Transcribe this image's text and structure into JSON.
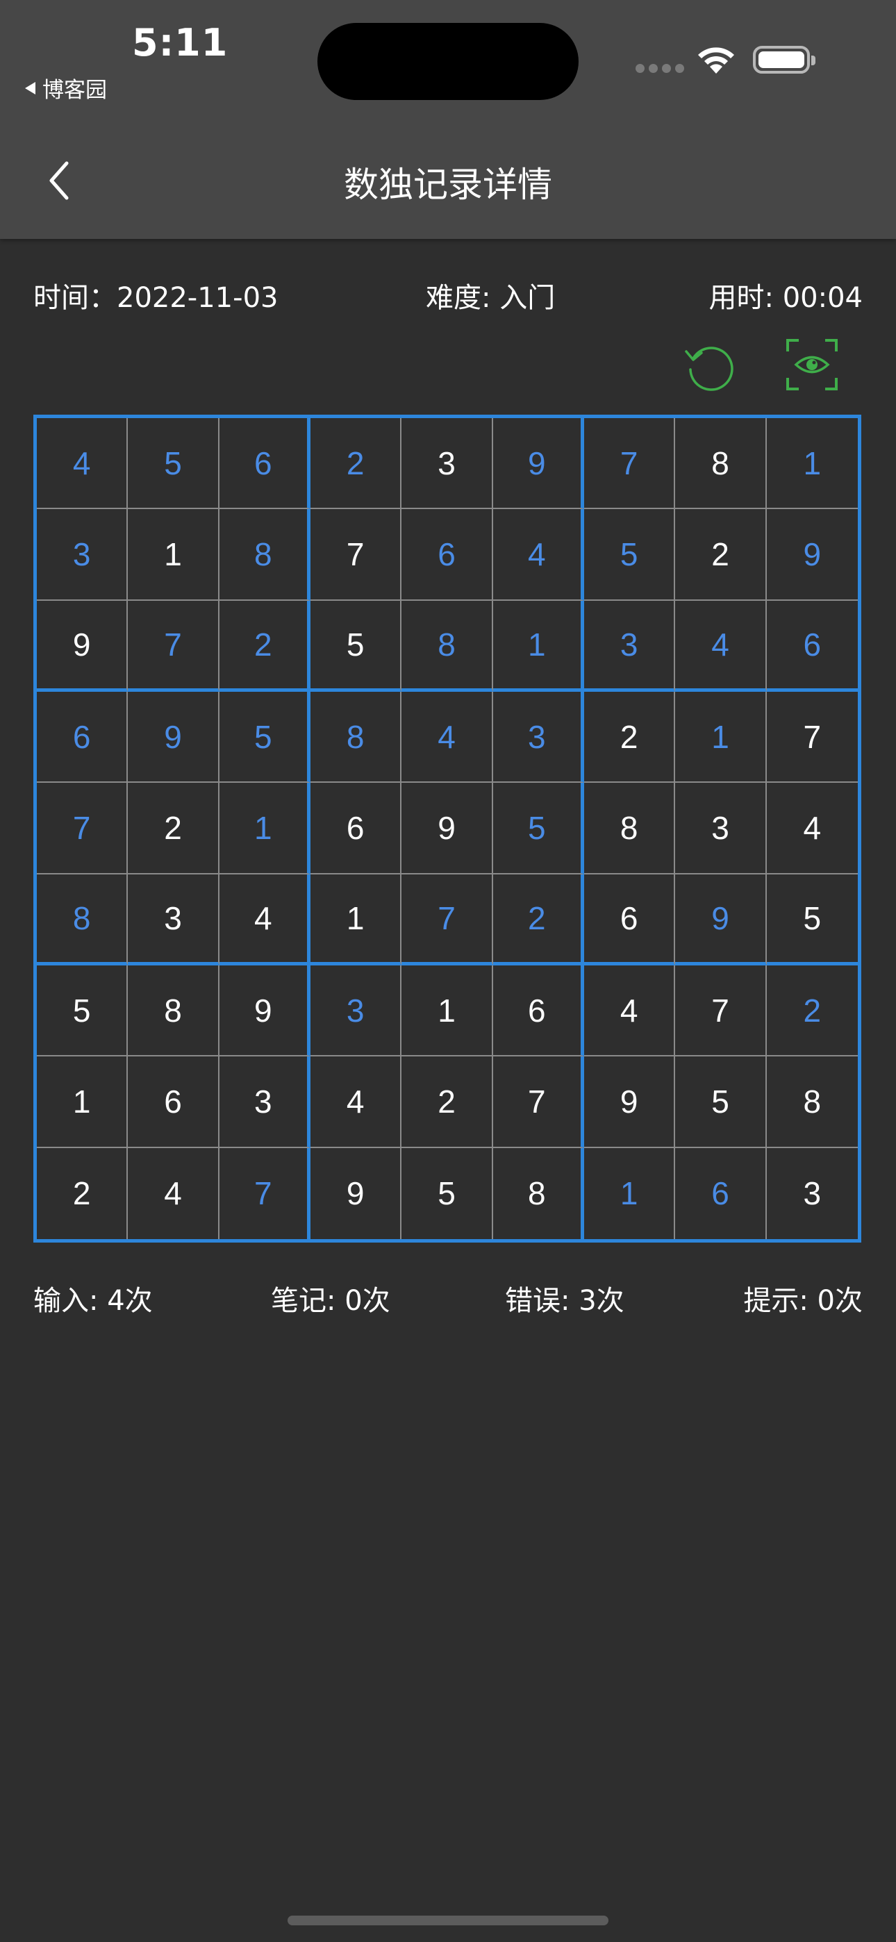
{
  "status_bar": {
    "time": "5:11",
    "back_app": "博客园"
  },
  "nav": {
    "title": "数独记录详情"
  },
  "info": {
    "date_label": "时间：",
    "date_value": "2022-11-03",
    "difficulty_label": "难度: ",
    "difficulty_value": "入门",
    "duration_label": "用时: ",
    "duration_value": "00:04"
  },
  "icons": {
    "restart": "restart-icon",
    "eye": "eye-scan-icon"
  },
  "colors": {
    "grid_border": "#2d86dc",
    "filled_digit": "#4a8ce6",
    "given_digit": "#ffffff",
    "action_icon": "#3fae4a"
  },
  "board": [
    [
      "4",
      "5",
      "6",
      "2",
      "3",
      "9",
      "7",
      "8",
      "1"
    ],
    [
      "3",
      "1",
      "8",
      "7",
      "6",
      "4",
      "5",
      "2",
      "9"
    ],
    [
      "9",
      "7",
      "2",
      "5",
      "8",
      "1",
      "3",
      "4",
      "6"
    ],
    [
      "6",
      "9",
      "5",
      "8",
      "4",
      "3",
      "2",
      "1",
      "7"
    ],
    [
      "7",
      "2",
      "1",
      "6",
      "9",
      "5",
      "8",
      "3",
      "4"
    ],
    [
      "8",
      "3",
      "4",
      "1",
      "7",
      "2",
      "6",
      "9",
      "5"
    ],
    [
      "5",
      "8",
      "9",
      "3",
      "1",
      "6",
      "4",
      "7",
      "2"
    ],
    [
      "1",
      "6",
      "3",
      "4",
      "2",
      "7",
      "9",
      "5",
      "8"
    ],
    [
      "2",
      "4",
      "7",
      "9",
      "5",
      "8",
      "1",
      "6",
      "3"
    ]
  ],
  "board_filled": [
    [
      1,
      1,
      1,
      1,
      0,
      1,
      1,
      0,
      1
    ],
    [
      1,
      0,
      1,
      0,
      1,
      1,
      1,
      0,
      1
    ],
    [
      0,
      1,
      1,
      0,
      1,
      1,
      1,
      1,
      1
    ],
    [
      1,
      1,
      1,
      1,
      1,
      1,
      0,
      1,
      0
    ],
    [
      1,
      0,
      1,
      0,
      0,
      1,
      0,
      0,
      0
    ],
    [
      1,
      0,
      0,
      0,
      1,
      1,
      0,
      1,
      0
    ],
    [
      0,
      0,
      0,
      1,
      0,
      0,
      0,
      0,
      1
    ],
    [
      0,
      0,
      0,
      0,
      0,
      0,
      0,
      0,
      0
    ],
    [
      0,
      0,
      1,
      0,
      0,
      0,
      1,
      1,
      0
    ]
  ],
  "stats": {
    "input": "输入: 4次",
    "notes": "笔记: 0次",
    "errors": "错误: 3次",
    "hints": "提示: 0次"
  }
}
